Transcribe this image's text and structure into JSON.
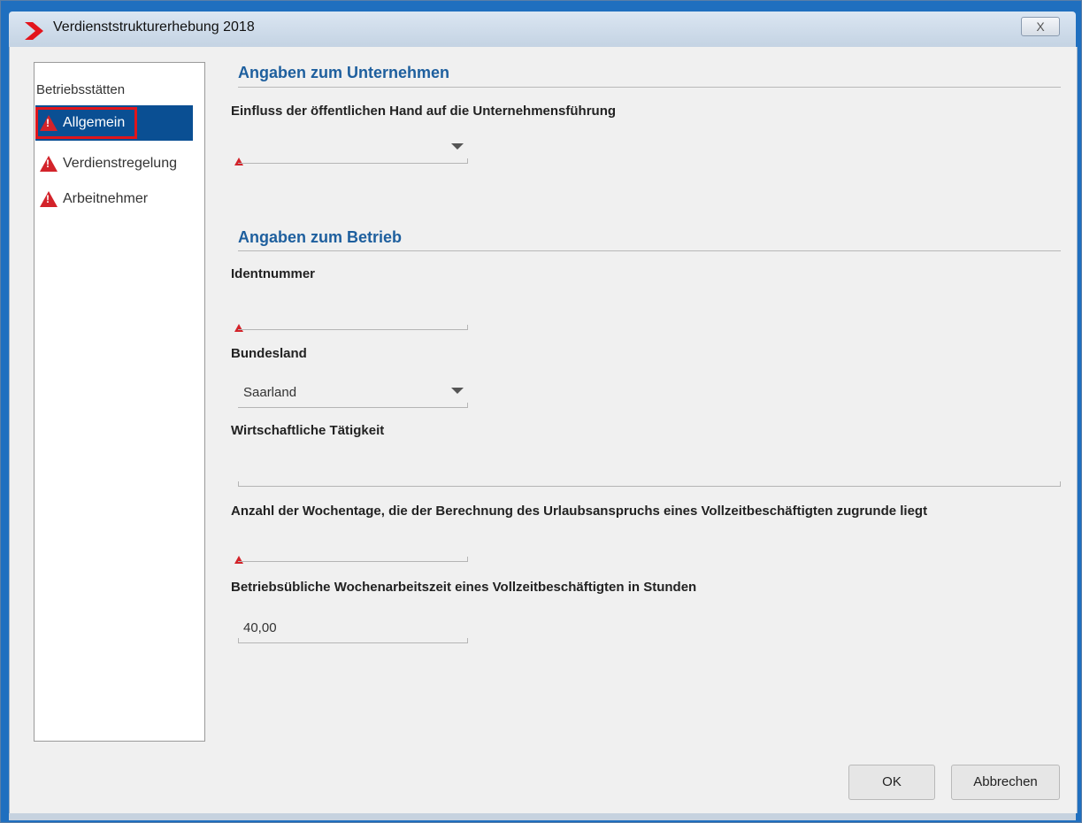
{
  "window": {
    "title": "Verdienststrukturerhebung 2018",
    "close_glyph": "X"
  },
  "sidebar": {
    "header": "Betriebsstätten",
    "items": [
      {
        "label": "Allgemein",
        "icon": "warning-icon",
        "active": true
      },
      {
        "label": "Verdienstregelung",
        "icon": "warning-icon",
        "active": false
      },
      {
        "label": "Arbeitnehmer",
        "icon": "warning-icon",
        "active": false
      }
    ]
  },
  "sections": {
    "unternehmen": {
      "title": "Angaben zum Unternehmen",
      "field_einfluss": {
        "label": "Einfluss der öffentlichen Hand auf die Unternehmensführung",
        "value": ""
      }
    },
    "betrieb": {
      "title": "Angaben zum Betrieb",
      "field_identnummer": {
        "label": "Identnummer",
        "value": ""
      },
      "field_bundesland": {
        "label": "Bundesland",
        "value": "Saarland"
      },
      "field_taetigkeit": {
        "label": "Wirtschaftliche Tätigkeit",
        "value": ""
      },
      "field_wochentage": {
        "label": "Anzahl der Wochentage, die der Berechnung des Urlaubsanspruchs eines Vollzeitbeschäftigten zugrunde liegt",
        "value": ""
      },
      "field_wochenarbeitszeit": {
        "label": "Betriebsübliche Wochenarbeitszeit eines Vollzeitbeschäftigten in Stunden",
        "value": "40,00"
      }
    }
  },
  "buttons": {
    "ok": "OK",
    "cancel": "Abbrechen"
  },
  "colors": {
    "accent": "#1e5f9e",
    "selection": "#0a4f93",
    "warning": "#d3232a",
    "highlight_border": "#e0151b"
  }
}
